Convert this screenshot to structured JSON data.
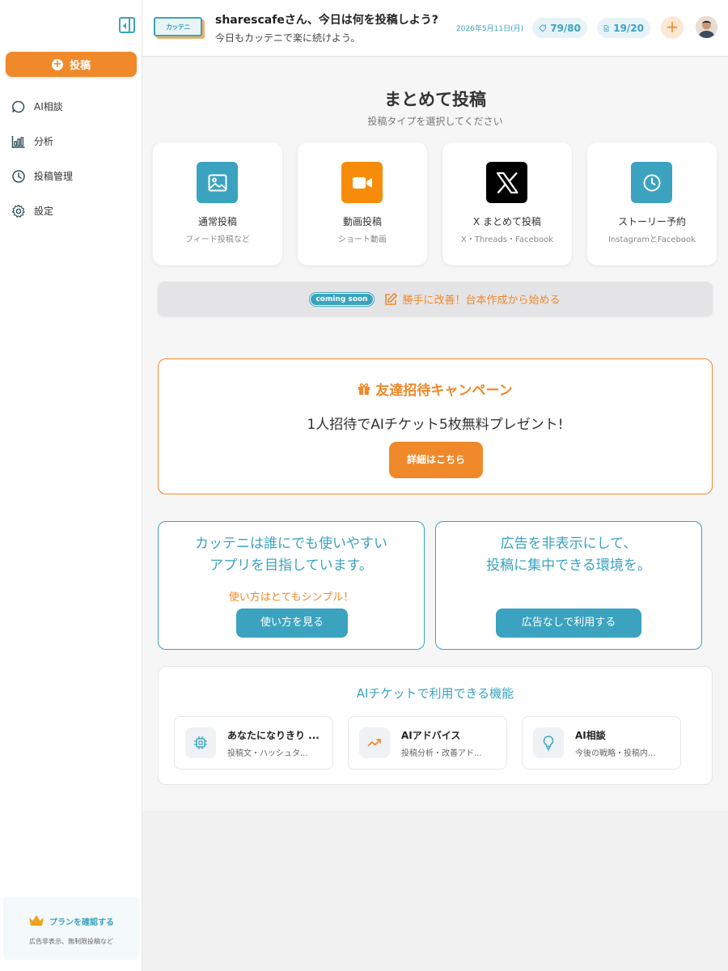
{
  "sidebar": {
    "post_button": "投稿",
    "items": [
      {
        "label": "AI相談",
        "icon": "chat-bubble-icon"
      },
      {
        "label": "分析",
        "icon": "bar-chart-icon"
      },
      {
        "label": "投稿管理",
        "icon": "clock-icon"
      },
      {
        "label": "設定",
        "icon": "gear-icon"
      }
    ],
    "plan": {
      "link": "プランを確認する",
      "sub": "広告非表示、無制限投稿など"
    }
  },
  "header": {
    "logo_text": "カッテニ",
    "greeting": "sharescafeさん、今日は何を投稿しよう?",
    "subtitle": "今日もカッテニで楽に続けよう。",
    "date": "2026年5月11日(月)",
    "tickets": "79/80",
    "posts": "19/20",
    "add_label": "+"
  },
  "main": {
    "title": "まとめて投稿",
    "subtitle": "投稿タイプを選択してください",
    "types": [
      {
        "label": "通常投稿",
        "desc": "フィード投稿など",
        "icon": "image-icon",
        "color": "#3ba3c0"
      },
      {
        "label": "動画投稿",
        "desc": "ショート動画",
        "icon": "video-camera-icon",
        "color": "#f78c0a"
      },
      {
        "label": "X まとめて投稿",
        "desc": "X・Threads・Facebook",
        "icon": "x-logo-icon",
        "color": "#000000"
      },
      {
        "label": "ストーリー予約",
        "desc": "InstagramとFacebook",
        "icon": "clock-icon",
        "color": "#3ba3c0"
      }
    ],
    "coming": {
      "badge": "coming soon",
      "text": "勝手に改善！台本作成から始める"
    },
    "campaign": {
      "title": "友達招待キャンペーン",
      "text": "1人招待でAIチケット5枚無料プレゼント!",
      "button": "詳細はこちら"
    },
    "info_left": {
      "line1": "カッテニは誰にでも使いやすい",
      "line2": "アプリを目指しています。",
      "accent": "使い方はとてもシンプル！",
      "button": "使い方を見る"
    },
    "info_right": {
      "line1": "広告を非表示にして、",
      "line2": "投稿に集中できる環境を。",
      "button": "広告なしで利用する"
    },
    "features": {
      "title": "AIチケットで利用できる機能",
      "items": [
        {
          "name": "あなたになりきり ...",
          "desc": "投稿文・ハッシュタ...",
          "icon": "chip-icon"
        },
        {
          "name": "AIアドバイス",
          "desc": "投稿分析・改善アド...",
          "icon": "trend-up-icon"
        },
        {
          "name": "AI相談",
          "desc": "今後の戦略・投稿内...",
          "icon": "lightbulb-icon"
        }
      ]
    }
  },
  "colors": {
    "brand_orange": "#f0892a",
    "brand_teal": "#3ba3c0"
  }
}
